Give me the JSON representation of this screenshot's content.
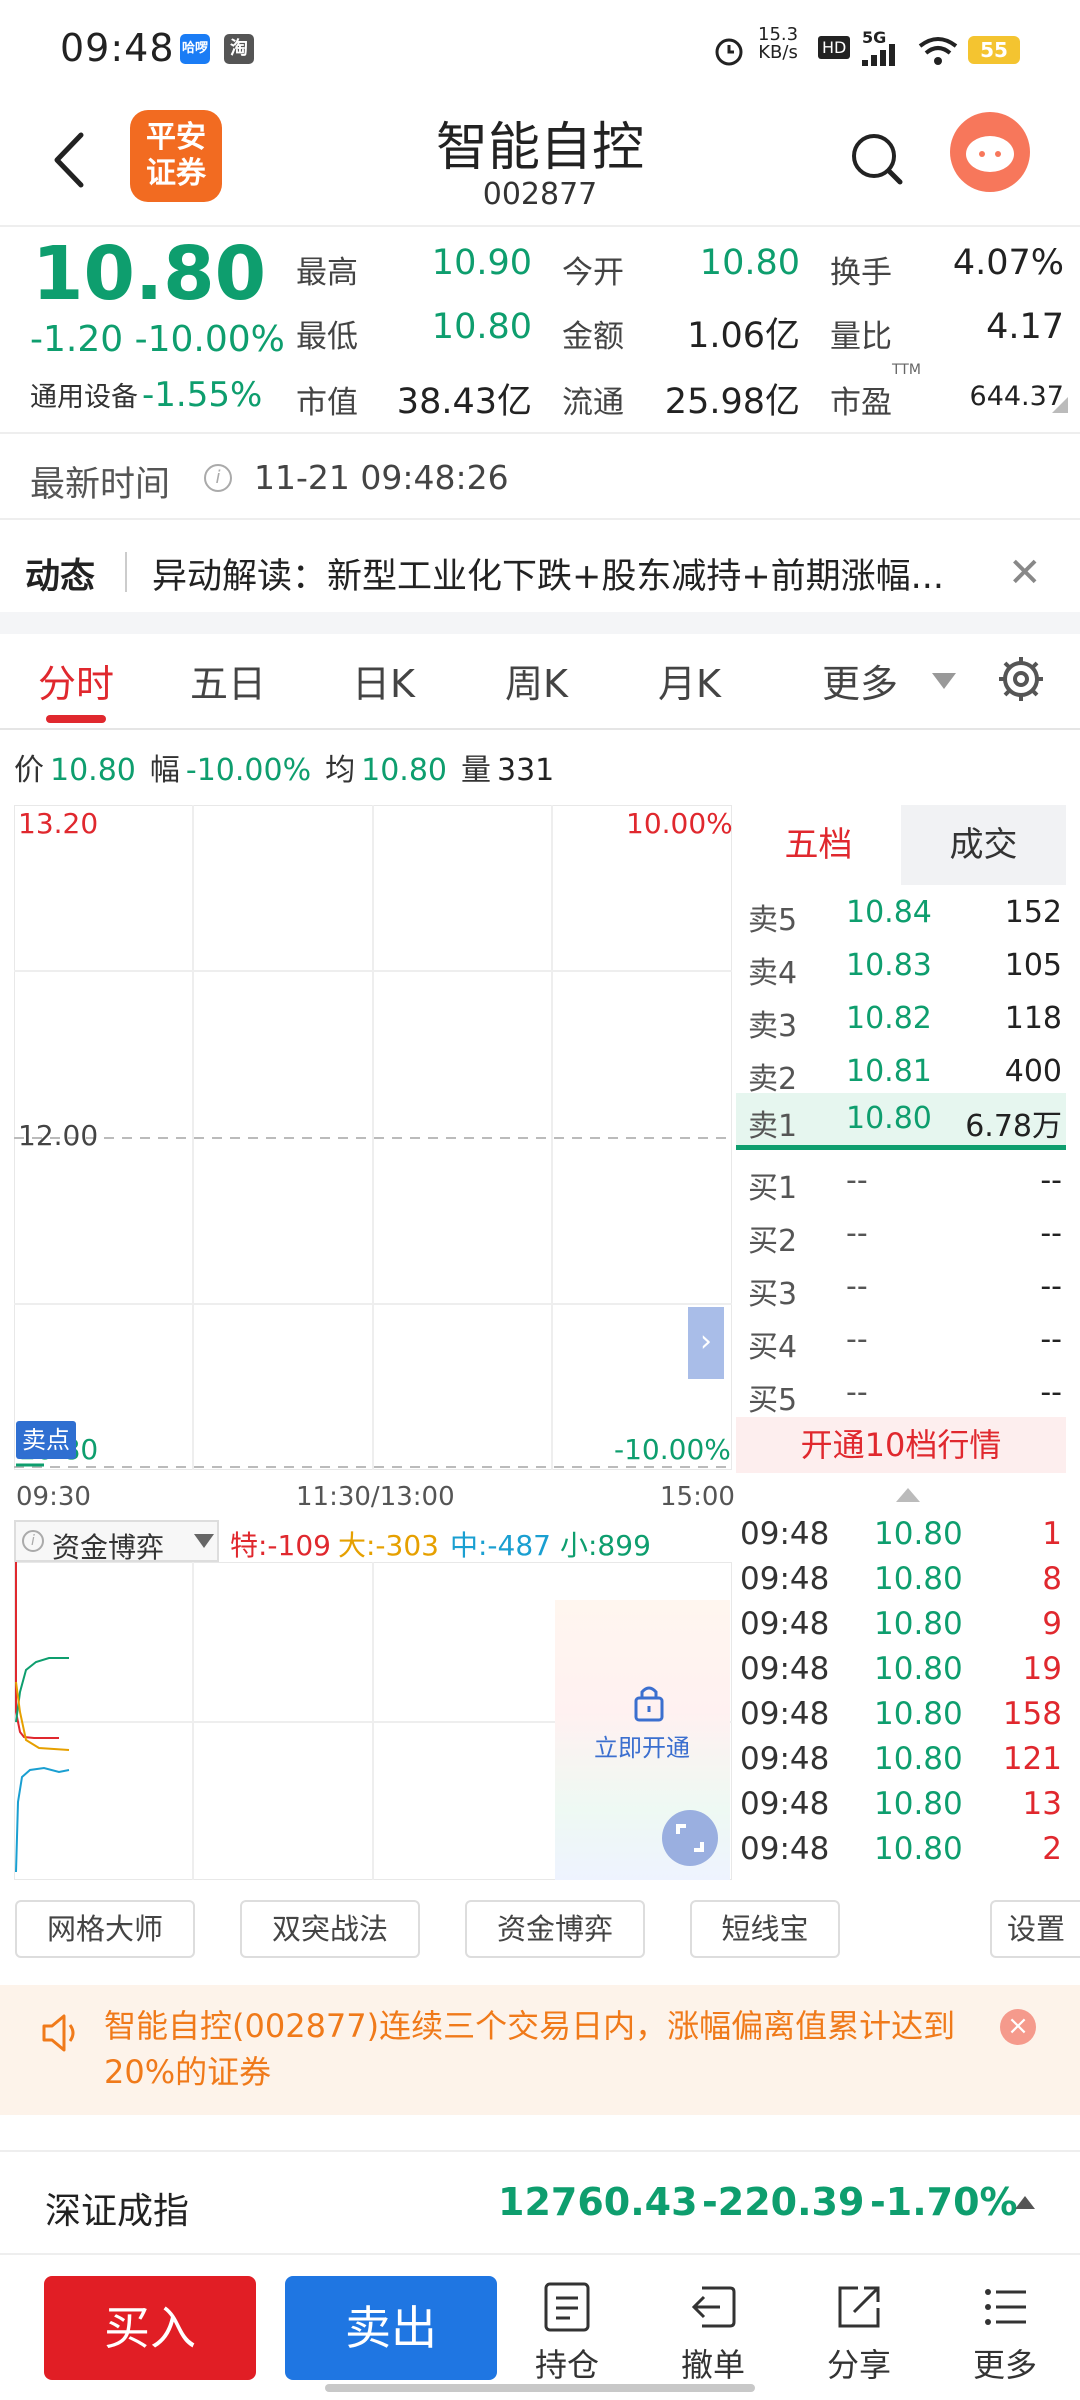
{
  "status_bar": {
    "time": "09:48",
    "app_icons": [
      "哈啰",
      "淘"
    ],
    "net_speed_top": "15.3",
    "net_speed_bottom": "KB/s",
    "hd": "HD",
    "signal": "5G",
    "battery": "55"
  },
  "header": {
    "logo_line1": "平安",
    "logo_line2": "证券",
    "title": "智能自控",
    "code": "002877"
  },
  "quote": {
    "price": "10.80",
    "change": "-1.20",
    "change_pct": "-10.00%",
    "sector_name": "通用设备",
    "sector_pct": "-1.55%",
    "ttm": "TTM",
    "fields": [
      {
        "label": "最高",
        "value": "10.90",
        "color": "green"
      },
      {
        "label": "今开",
        "value": "10.80",
        "color": "green"
      },
      {
        "label": "换手",
        "value": "4.07%",
        "color": "black"
      },
      {
        "label": "最低",
        "value": "10.80",
        "color": "green"
      },
      {
        "label": "金额",
        "value": "1.06亿",
        "color": "black"
      },
      {
        "label": "量比",
        "value": "4.17",
        "color": "black"
      },
      {
        "label": "市值",
        "value": "38.43亿",
        "color": "black"
      },
      {
        "label": "流通",
        "value": "25.98亿",
        "color": "black"
      },
      {
        "label": "市盈",
        "value": "644.37",
        "color": "black"
      }
    ]
  },
  "latest_time": {
    "label": "最新时间",
    "info_icon": "i",
    "value": "11-21 09:48:26"
  },
  "news": {
    "tag": "动态",
    "text": "异动解读：新型工业化下跌+股东减持+前期涨幅..."
  },
  "tabs": [
    {
      "label": "分时",
      "active": true
    },
    {
      "label": "五日",
      "active": false
    },
    {
      "label": "日K",
      "active": false
    },
    {
      "label": "周K",
      "active": false
    },
    {
      "label": "月K",
      "active": false
    },
    {
      "label": "更多",
      "active": false
    }
  ],
  "price_info": {
    "price_label": "价",
    "price": "10.80",
    "amp_label": "幅",
    "amp": "-10.00%",
    "avg_label": "均",
    "avg": "10.80",
    "vol_label": "量",
    "vol": "331"
  },
  "chart": {
    "y_top": "13.20",
    "y_mid": "12.00",
    "y_bottom": "10.80",
    "pct_top": "10.00%",
    "pct_bottom": "-10.00%",
    "sell_marker": "卖点",
    "x_start": "09:30",
    "x_mid": "11:30/13:00",
    "x_end": "15:00",
    "colors": {
      "up": "#e0282e",
      "down": "#0e9e6e"
    }
  },
  "order_book": {
    "tab_active": "五档",
    "tab_inactive": "成交",
    "asks": [
      {
        "label": "卖5",
        "price": "10.84",
        "vol": "152"
      },
      {
        "label": "卖4",
        "price": "10.83",
        "vol": "105"
      },
      {
        "label": "卖3",
        "price": "10.82",
        "vol": "118"
      },
      {
        "label": "卖2",
        "price": "10.81",
        "vol": "400"
      },
      {
        "label": "卖1",
        "price": "10.80",
        "vol": "6.78万"
      }
    ],
    "bids": [
      {
        "label": "买1",
        "price": "--",
        "vol": "--"
      },
      {
        "label": "买2",
        "price": "--",
        "vol": "--"
      },
      {
        "label": "买3",
        "price": "--",
        "vol": "--"
      },
      {
        "label": "买4",
        "price": "--",
        "vol": "--"
      },
      {
        "label": "买5",
        "price": "--",
        "vol": "--"
      }
    ],
    "open_10": "开通10档行情"
  },
  "fund": {
    "title": "资金博弈",
    "te": "特:-109",
    "da": "大:-303",
    "zhong": "中:-487",
    "xiao": "小:899",
    "unlock": "立即开通"
  },
  "ticks": [
    {
      "time": "09:48",
      "price": "10.80",
      "vol": "1"
    },
    {
      "time": "09:48",
      "price": "10.80",
      "vol": "8"
    },
    {
      "time": "09:48",
      "price": "10.80",
      "vol": "9"
    },
    {
      "time": "09:48",
      "price": "10.80",
      "vol": "19"
    },
    {
      "time": "09:48",
      "price": "10.80",
      "vol": "158"
    },
    {
      "time": "09:48",
      "price": "10.80",
      "vol": "121"
    },
    {
      "time": "09:48",
      "price": "10.80",
      "vol": "13"
    },
    {
      "time": "09:48",
      "price": "10.80",
      "vol": "2"
    }
  ],
  "tools": [
    "网格大师",
    "双突战法",
    "资金博弈",
    "短线宝",
    "设置"
  ],
  "alert": {
    "text": "智能自控(002877)连续三个交易日内，涨幅偏离值累计达到20%的证券"
  },
  "index": {
    "name": "深证成指",
    "value": "12760.43",
    "change": "-220.39",
    "pct": "-1.70%"
  },
  "bottom_bar": {
    "buy": "买入",
    "sell": "卖出",
    "nav": [
      "持仓",
      "撤单",
      "分享",
      "更多"
    ]
  }
}
